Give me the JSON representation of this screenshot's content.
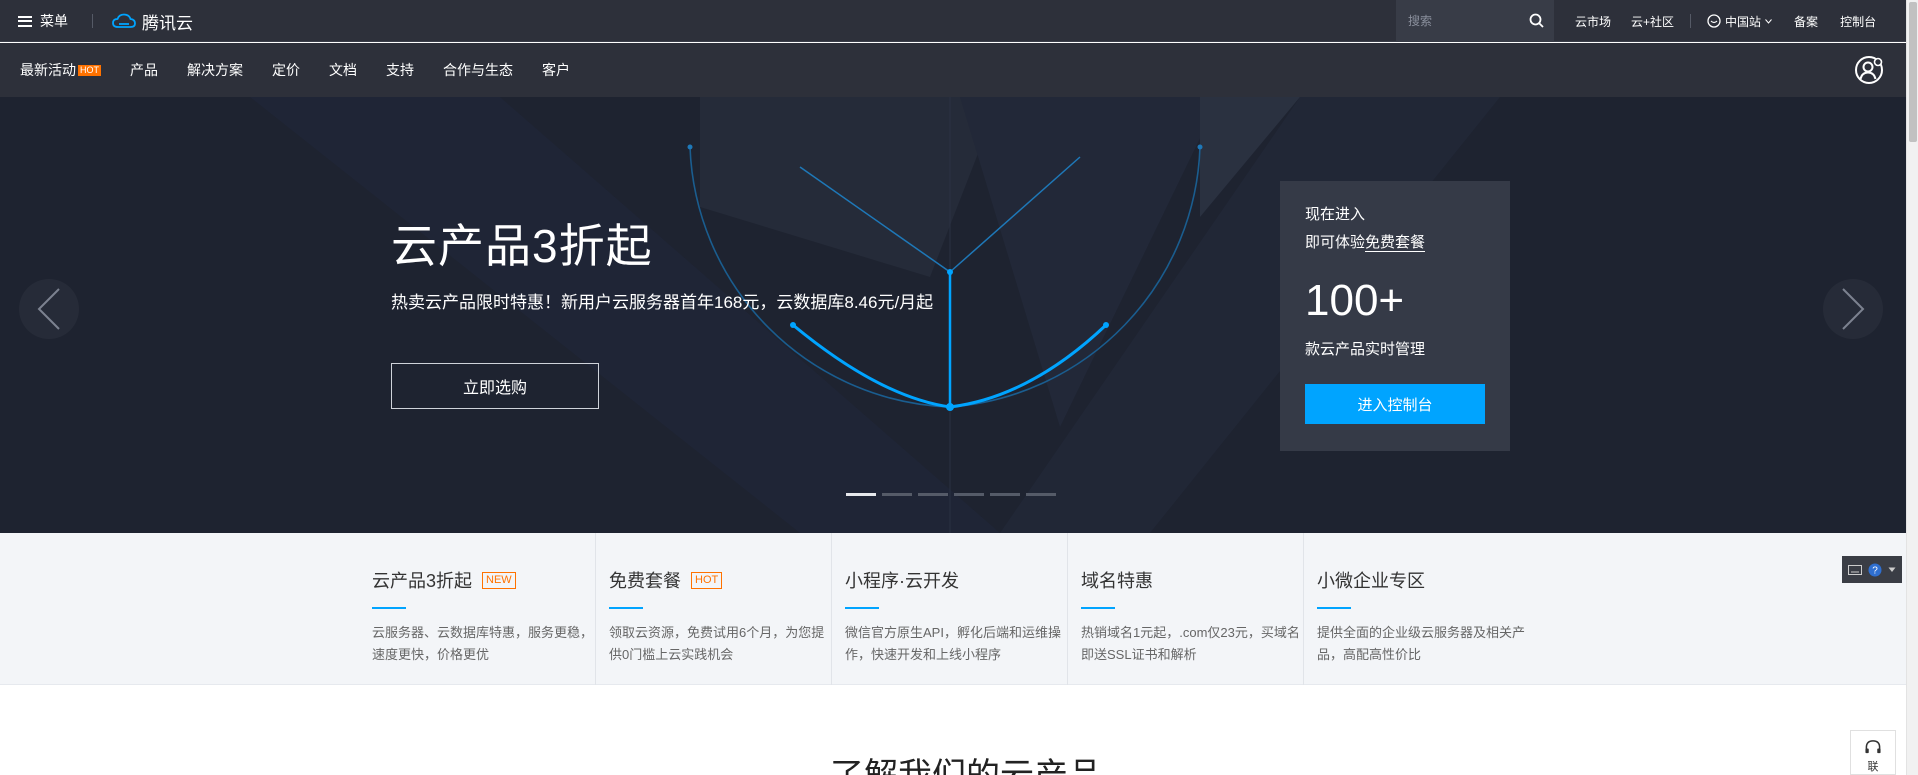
{
  "topbar": {
    "menu_label": "菜单",
    "brand": "腾讯云",
    "search_placeholder": "搜索",
    "links": {
      "market": "云市场",
      "community": "云+社区",
      "region": "中国站",
      "beian": "备案",
      "console": "控制台"
    }
  },
  "nav": {
    "items": [
      "最新活动",
      "产品",
      "解决方案",
      "定价",
      "文档",
      "支持",
      "合作与生态",
      "客户"
    ],
    "hot_badge": "HOT"
  },
  "hero": {
    "title": "云产品3折起",
    "subtitle": "热卖云产品限时特惠！新用户云服务器首年168元，云数据库8.46元/月起",
    "button": "立即选购",
    "slide_count": 6,
    "active_slide": 1
  },
  "promo": {
    "line1": "现在进入",
    "line2_prefix": "即可体验",
    "line2_link": "免费套餐",
    "number": "100+",
    "desc": "款云产品实时管理",
    "button": "进入控制台"
  },
  "features": [
    {
      "title": "云产品3折起",
      "tag": "NEW",
      "desc": "云服务器、云数据库特惠，服务更稳，速度更快，价格更优"
    },
    {
      "title": "免费套餐",
      "tag": "HOT",
      "desc": "领取云资源，免费试用6个月，为您提供0门槛上云实践机会"
    },
    {
      "title": "小程序·云开发",
      "tag": "",
      "desc": "微信官方原生API，孵化后端和运维操作，快速开发和上线小程序"
    },
    {
      "title": "域名特惠",
      "tag": "",
      "desc": "热销域名1元起，.com仅23元，买域名即送SSL证书和解析"
    },
    {
      "title": "小微企业专区",
      "tag": "",
      "desc": "提供全面的企业级云服务器及相关产品，高配高性价比"
    }
  ],
  "section": {
    "title": "了解我们的云产品"
  },
  "contact_label": "联",
  "colors": {
    "header_bg": "#2d303a",
    "hero_bg": "#1e2330",
    "accent_blue": "#00a4ff",
    "hot_orange": "#ff7200"
  }
}
